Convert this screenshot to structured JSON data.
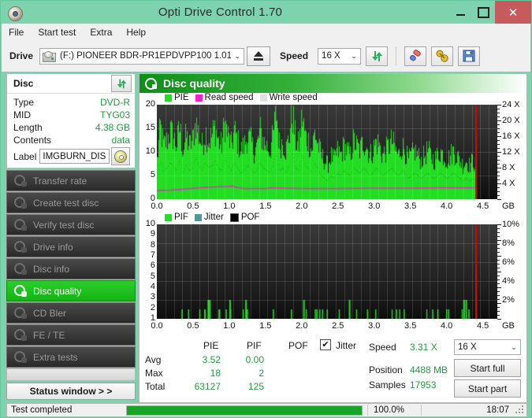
{
  "window": {
    "title": "Opti Drive Control 1.70",
    "icon": "disc-icon",
    "minimize": "–",
    "maximize": "□",
    "close": "✕"
  },
  "menu": {
    "items": [
      "File",
      "Start test",
      "Extra",
      "Help"
    ]
  },
  "toolbar": {
    "drive_label": "Drive",
    "drive_value": "(F:)   PIONEER BDR-PR1EPDVPP100 1.01",
    "eject_label": "eject-button",
    "speed_label": "Speed",
    "speed_value": "16 X",
    "refresh_icon": "refresh-icon",
    "erase_icon": "eraser-icon",
    "tools_icon": "tools-icon",
    "save_icon": "save-icon",
    "dropdown_arrow": "⌄"
  },
  "disc_panel": {
    "title": "Disc",
    "refresh_icon": "refresh-icon",
    "rows": [
      {
        "key": "Type",
        "value": "DVD-R"
      },
      {
        "key": "MID",
        "value": "TYG03"
      },
      {
        "key": "Length",
        "value": "4.38 GB"
      },
      {
        "key": "Contents",
        "value": "data"
      }
    ],
    "label_key": "Label",
    "label_value": "IMGBURN_DIS",
    "label_icon": "cd-icon"
  },
  "nav": {
    "items": [
      {
        "label": "Transfer rate",
        "active": false
      },
      {
        "label": "Create test disc",
        "active": false
      },
      {
        "label": "Verify test disc",
        "active": false
      },
      {
        "label": "Drive info",
        "active": false
      },
      {
        "label": "Disc info",
        "active": false
      },
      {
        "label": "Disc quality",
        "active": true
      },
      {
        "label": "CD Bler",
        "active": false
      },
      {
        "label": "FE / TE",
        "active": false
      },
      {
        "label": "Extra tests",
        "active": false
      }
    ],
    "status_window": "Status window > >"
  },
  "content": {
    "header_title": "Disc quality",
    "header_icon": "disc-quality-icon"
  },
  "stats": {
    "col_headers": [
      "PIE",
      "PIF",
      "POF"
    ],
    "row_headers": [
      "Avg",
      "Max",
      "Total"
    ],
    "pie": {
      "avg": "3.52",
      "max": "18",
      "total": "63127"
    },
    "pif": {
      "avg": "0.00",
      "max": "2",
      "total": "125"
    },
    "pof": {
      "avg": "",
      "max": "",
      "total": ""
    },
    "jitter_label": "Jitter",
    "jitter_checked": "✔",
    "speed_label": "Speed",
    "speed_value": "3.31 X",
    "position_label": "Position",
    "position_value": "4488 MB",
    "samples_label": "Samples",
    "samples_value": "17953",
    "speed_select": "16 X",
    "start_full": "Start full",
    "start_part": "Start part",
    "dropdown_arrow": "⌄"
  },
  "statusbar": {
    "text": "Test completed",
    "percent": "100.0%",
    "progress": 100,
    "time": "18:07"
  },
  "colors": {
    "pie_green": "#22dd22",
    "read_speed_magenta": "#ee22cc",
    "write_speed_gray": "#e0e0e0",
    "jitter_teal": "#4a9a9a",
    "pof_black": "#000000",
    "accent_green": "#12b412",
    "title_bg": "#7dd3ae",
    "close_red": "#c75b5b"
  },
  "chart_data": [
    {
      "type": "area",
      "id": "pie-chart",
      "title": "Disc quality",
      "xlabel": "GB",
      "ylabel": "PIE",
      "xlim": [
        0,
        4.7
      ],
      "ylim": [
        0,
        20
      ],
      "y2lim": [
        0,
        24
      ],
      "y2label": "X",
      "grid": true,
      "legend_position": "top-left",
      "xticks": [
        "0.0",
        "0.5",
        "1.0",
        "1.5",
        "2.0",
        "2.5",
        "3.0",
        "3.5",
        "4.0",
        "4.5"
      ],
      "xtick_suffix": "GB",
      "yticks": [
        "20",
        "15",
        "10",
        "5",
        "0"
      ],
      "y2ticks": [
        "24 X",
        "20 X",
        "16 X",
        "12 X",
        "8 X",
        "4 X"
      ],
      "legend": [
        {
          "name": "PIE",
          "color": "#22dd22"
        },
        {
          "name": "Read speed",
          "color": "#ee22cc"
        },
        {
          "name": "Write speed",
          "color": "#e0e0e0"
        }
      ],
      "series": [
        {
          "name": "PIE",
          "color": "#22dd22",
          "type": "bar",
          "x": [
            0.0,
            0.05,
            0.09,
            0.14,
            0.18,
            0.23,
            0.27,
            0.32,
            0.36,
            0.41,
            0.45,
            0.5,
            0.54,
            0.59,
            0.63,
            0.68,
            0.72,
            0.77,
            0.81,
            0.86,
            0.9,
            0.95,
            0.99,
            1.04,
            1.08,
            1.13,
            1.17,
            1.22,
            1.26,
            1.31,
            1.35,
            1.4,
            1.44,
            1.49,
            1.53,
            1.58,
            1.62,
            1.67,
            1.71,
            1.76,
            1.8,
            1.85,
            1.89,
            1.94,
            1.98,
            2.03,
            2.07,
            2.12,
            2.16,
            2.21,
            2.25,
            2.3,
            2.34,
            2.39,
            2.43,
            2.48,
            2.52,
            2.57,
            2.61,
            2.66,
            2.7,
            2.75,
            2.79,
            2.84,
            2.88,
            2.93,
            2.97,
            3.02,
            3.06,
            3.11,
            3.15,
            3.2,
            3.24,
            3.29,
            3.33,
            3.38,
            3.42,
            3.47,
            3.51,
            3.56,
            3.6,
            3.65,
            3.69,
            3.74,
            3.78,
            3.83,
            3.87,
            3.92,
            3.96,
            4.01,
            4.05,
            4.1,
            4.14,
            4.19,
            4.23,
            4.28,
            4.32,
            4.37,
            4.41,
            4.46
          ],
          "values": [
            8,
            15,
            11,
            12,
            14,
            13,
            11,
            15,
            10,
            13,
            11,
            12,
            16,
            13,
            11,
            14,
            12,
            13,
            15,
            12,
            11,
            16,
            13,
            11,
            14,
            12,
            10,
            11,
            13,
            12,
            10,
            11,
            14,
            12,
            11,
            10,
            13,
            18,
            11,
            12,
            10,
            13,
            18,
            12,
            11,
            17,
            13,
            12,
            10,
            14,
            11,
            9,
            8,
            7,
            9,
            8,
            10,
            9,
            11,
            10,
            9,
            12,
            11,
            10,
            12,
            11,
            9,
            10,
            12,
            11,
            9,
            10,
            11,
            12,
            10,
            9,
            11,
            10,
            8,
            9,
            10,
            9,
            8,
            9,
            10,
            9,
            8,
            9,
            10,
            9,
            8,
            9,
            10,
            9,
            8,
            7,
            8,
            7,
            8,
            7
          ]
        },
        {
          "name": "Read speed",
          "color": "#ee22cc",
          "type": "line",
          "x": [
            0.0,
            0.2,
            0.4,
            0.6,
            0.8,
            0.95,
            1.05,
            1.1,
            1.2,
            1.5,
            1.6,
            2.0,
            2.5,
            3.0,
            3.5,
            4.0,
            4.4
          ],
          "values": [
            2.2,
            2.3,
            2.6,
            2.9,
            3.1,
            3.2,
            3.3,
            3.0,
            2.7,
            2.7,
            2.9,
            2.7,
            2.7,
            2.8,
            2.8,
            2.9,
            2.9
          ],
          "axis": "right"
        }
      ],
      "markers": [
        {
          "name": "position-marker",
          "x": 4.4,
          "color": "#e00000"
        }
      ]
    },
    {
      "type": "bar",
      "id": "pif-chart",
      "xlabel": "GB",
      "ylabel": "PIF",
      "xlim": [
        0,
        4.7
      ],
      "ylim": [
        0,
        10
      ],
      "y2lim": [
        0,
        10
      ],
      "y2label": "%",
      "grid": true,
      "legend_position": "top-left",
      "xticks": [
        "0.0",
        "0.5",
        "1.0",
        "1.5",
        "2.0",
        "2.5",
        "3.0",
        "3.5",
        "4.0",
        "4.5"
      ],
      "xtick_suffix": "GB",
      "yticks": [
        "10",
        "9",
        "8",
        "7",
        "6",
        "5",
        "4",
        "3",
        "2",
        "1"
      ],
      "y2ticks": [
        "10%",
        "8%",
        "6%",
        "4%",
        "2%"
      ],
      "legend": [
        {
          "name": "PIF",
          "color": "#22dd22"
        },
        {
          "name": "Jitter",
          "color": "#4a9a9a"
        },
        {
          "name": "POF",
          "color": "#000000"
        }
      ],
      "series": [
        {
          "name": "PIF",
          "color": "#22dd22",
          "type": "bar",
          "x": [
            0.34,
            0.43,
            0.7,
            0.72,
            0.85,
            0.95,
            1.0,
            1.01,
            1.22,
            1.24,
            1.6,
            1.85,
            2.02,
            2.2,
            2.28,
            2.65,
            2.9,
            3.3,
            3.8,
            3.87,
            4.02,
            4.23,
            4.26,
            4.3
          ],
          "values": [
            1,
            1,
            2,
            2,
            1,
            1,
            2,
            1,
            2,
            1,
            1,
            1,
            2,
            1,
            1,
            2,
            1,
            1,
            1,
            1,
            1,
            2,
            2,
            1
          ]
        }
      ],
      "markers": [
        {
          "name": "position-marker",
          "x": 4.4,
          "color": "#e00000"
        }
      ]
    }
  ]
}
